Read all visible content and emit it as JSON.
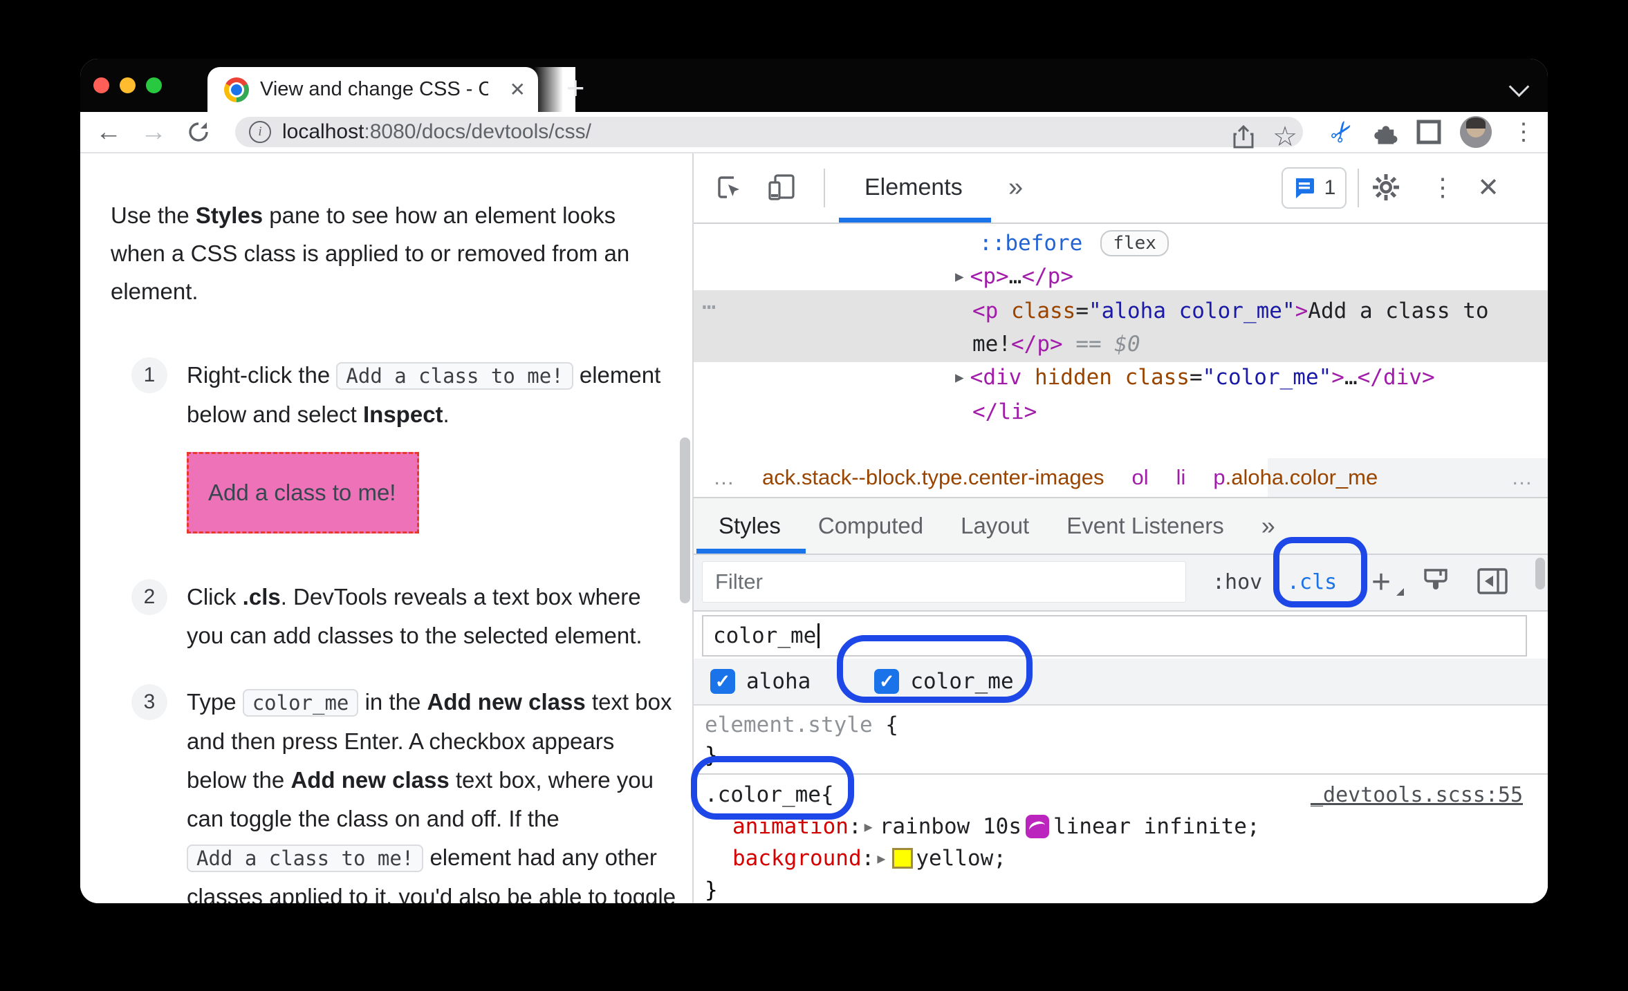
{
  "colors": {
    "accent_blue": "#1a73e8",
    "annotation_blue": "#1d47e6",
    "demo_pink": "#ee72b8",
    "demo_border_red": "#e8392e",
    "swatch_yellow": "#ffff00",
    "checkbox_blue": "#1a73e8"
  },
  "icons": {
    "back": "←",
    "forward": "→",
    "star": "☆",
    "new_tab": "+",
    "tab_close": "✕",
    "devtools_close": "✕",
    "kebab": "⋮",
    "more_tabs": "»",
    "more_subtabs": "»",
    "check": "✓",
    "breadcrumb_overflow": "…",
    "dom_more": "⋯",
    "scissors": "✂",
    "styles_add": "+"
  },
  "browser": {
    "tab_title": "View and change CSS - Chrom",
    "url_host": "localhost",
    "url_path": ":8080/docs/devtools/css/"
  },
  "tutorial": {
    "intro": [
      {
        "t": "Use the ",
        "c": "plain"
      },
      {
        "t": "Styles",
        "c": "b"
      },
      {
        "t": " pane to see how an element looks when a CSS class is applied to or removed from an element.",
        "c": "plain"
      }
    ],
    "steps": [
      {
        "num": "1",
        "tokens": [
          {
            "t": "Right-click the ",
            "c": "plain"
          },
          {
            "t": "Add a class to me!",
            "c": "code"
          },
          {
            "t": " element below and select ",
            "c": "plain"
          },
          {
            "t": "Inspect",
            "c": "b"
          },
          {
            "t": ".",
            "c": "plain"
          }
        ],
        "demo_label": "Add a class to me!"
      },
      {
        "num": "2",
        "tokens": [
          {
            "t": "Click ",
            "c": "plain"
          },
          {
            "t": ".cls",
            "c": "b"
          },
          {
            "t": ". DevTools reveals a text box where you can add classes to the selected element.",
            "c": "plain"
          }
        ]
      },
      {
        "num": "3",
        "tokens": [
          {
            "t": "Type ",
            "c": "plain"
          },
          {
            "t": "color_me",
            "c": "code"
          },
          {
            "t": " in the ",
            "c": "plain"
          },
          {
            "t": "Add new class",
            "c": "b"
          },
          {
            "t": " text box and then press Enter. A checkbox appears below the ",
            "c": "plain"
          },
          {
            "t": "Add new class",
            "c": "b"
          },
          {
            "t": " text box, where you can toggle the class on and off. If the ",
            "c": "plain"
          },
          {
            "t": "Add a class to me!",
            "c": "code"
          },
          {
            "t": " element had any other classes applied to it, you'd also be able to toggle them from here.",
            "c": "plain"
          }
        ]
      }
    ]
  },
  "devtools": {
    "panel_tab": "Elements",
    "issues_count": "1",
    "dom_lines": [
      [
        {
          "t": "::before",
          "c": "pseudo"
        },
        {
          "t": "flex",
          "c": "badge"
        }
      ],
      [
        {
          "t": "▶",
          "c": "arrow"
        },
        {
          "t": "<p>",
          "c": "tag"
        },
        {
          "t": "…",
          "c": "plain"
        },
        {
          "t": "</p>",
          "c": "tag"
        }
      ],
      [
        {
          "t": "<p ",
          "c": "tag"
        },
        {
          "t": "class",
          "c": "attr"
        },
        {
          "t": "=",
          "c": "plain"
        },
        {
          "t": "\"aloha color_me\"",
          "c": "val"
        },
        {
          "t": ">",
          "c": "tag"
        },
        {
          "t": "Add a class to",
          "c": "plain"
        }
      ],
      [
        {
          "t": "me!",
          "c": "plain"
        },
        {
          "t": "</p>",
          "c": "tag"
        },
        {
          "t": " == ",
          "c": "eq"
        },
        {
          "t": "$0",
          "c": "dollar"
        }
      ],
      [
        {
          "t": "▶",
          "c": "arrow"
        },
        {
          "t": "<div ",
          "c": "tag"
        },
        {
          "t": "hidden",
          "c": "attr"
        },
        {
          "t": " ",
          "c": "plain"
        },
        {
          "t": "class",
          "c": "attr"
        },
        {
          "t": "=",
          "c": "plain"
        },
        {
          "t": "\"color_me\"",
          "c": "val"
        },
        {
          "t": ">",
          "c": "tag"
        },
        {
          "t": "…",
          "c": "plain"
        },
        {
          "t": "</div>",
          "c": "tag"
        }
      ],
      [
        {
          "t": "</li>",
          "c": "tag"
        }
      ]
    ],
    "breadcrumbs": [
      {
        "t": "…",
        "c": "dots crumb"
      },
      {
        "t": "ack.stack--block.type.center-images",
        "c": "cls crumb"
      },
      {
        "t": "ol",
        "c": "el crumb"
      },
      {
        "t": "li",
        "c": "el crumb"
      },
      {
        "t": "p",
        "c": "el"
      },
      {
        "t": ".aloha.color_me",
        "c": "cls"
      },
      {
        "t": "…",
        "c": "push"
      }
    ],
    "styles_pane": {
      "subtabs": [
        "Styles",
        "Computed",
        "Layout",
        "Event Listeners"
      ],
      "filter_placeholder": "Filter",
      "hov_label": ":hov",
      "cls_label": ".cls",
      "class_input_value": "color_me",
      "checkboxes": [
        {
          "label": "aloha",
          "checked": true
        },
        {
          "label": "color_me",
          "checked": true
        }
      ],
      "element_style_open": [
        {
          "t": "element.style",
          "c": "muted"
        },
        {
          "t": " {",
          "c": "plain"
        }
      ],
      "element_style_close": "}",
      "rule": {
        "selector_line": [
          {
            "t": ".color_me",
            "c": "plain"
          },
          {
            "t": " {",
            "c": "plain"
          }
        ],
        "source_link": "_devtools.scss:55",
        "animation_line": [
          {
            "t": "animation",
            "c": "prop"
          },
          {
            "t": ": ",
            "c": "plain"
          },
          {
            "t": "▶",
            "c": "exp"
          },
          {
            "t": "rainbow 10s",
            "c": "plain"
          },
          {
            "t": "",
            "c": "animicon"
          },
          {
            "t": "linear infinite;",
            "c": "plain"
          }
        ],
        "background_line": [
          {
            "t": "background",
            "c": "prop"
          },
          {
            "t": ": ",
            "c": "plain"
          },
          {
            "t": "▶",
            "c": "exp"
          },
          {
            "t": "",
            "c": "swatch"
          },
          {
            "t": "yellow;",
            "c": "plain"
          }
        ],
        "close_brace": "}"
      }
    }
  }
}
